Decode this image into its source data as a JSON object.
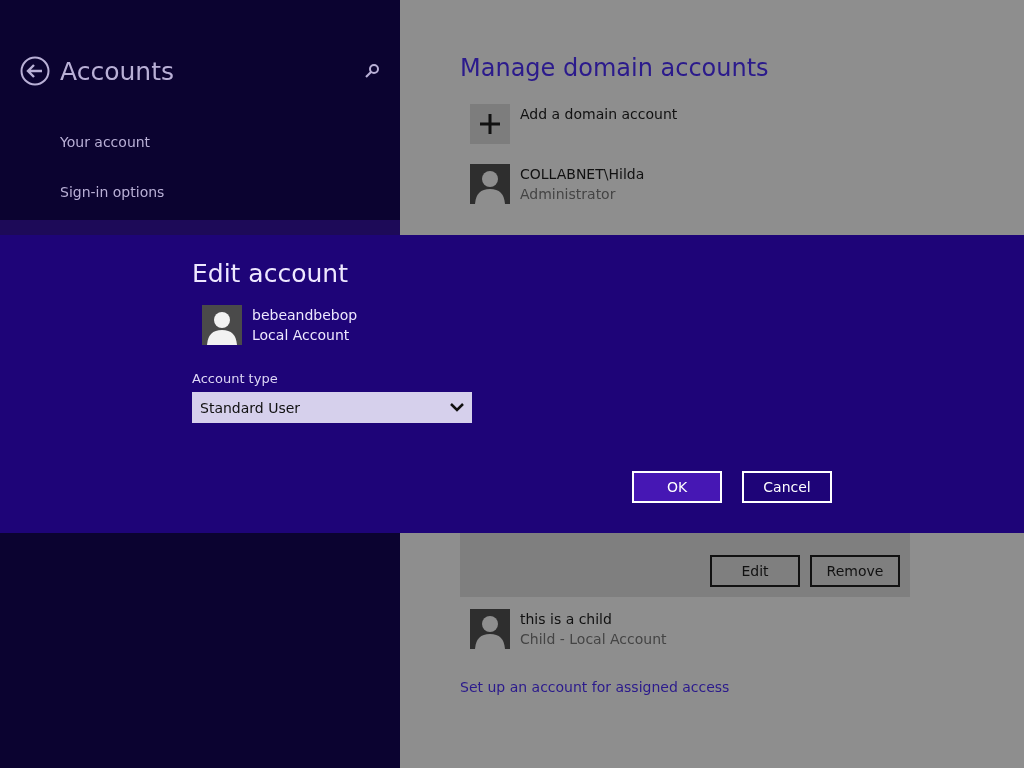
{
  "sidebar": {
    "title": "Accounts",
    "items": [
      {
        "label": "Your account"
      },
      {
        "label": "Sign-in options"
      }
    ]
  },
  "main": {
    "title": "Manage domain accounts",
    "add_label": "Add a domain account",
    "accounts_top": [
      {
        "name": "COLLABNET\\Hilda",
        "detail": "Administrator"
      }
    ],
    "selected_actions": [
      "Edit",
      "Remove"
    ],
    "accounts_bottom": [
      {
        "name": "this is a child",
        "detail": "Child - Local Account"
      }
    ],
    "link": "Set up an account for assigned access"
  },
  "dialog": {
    "title": "Edit account",
    "account": {
      "name": "bebeandbebop",
      "type": "Local Account"
    },
    "field_label": "Account type",
    "dropdown_value": "Standard User",
    "buttons": [
      {
        "label": "OK",
        "kind": "primary"
      },
      {
        "label": "Cancel",
        "kind": "secondary"
      }
    ]
  }
}
